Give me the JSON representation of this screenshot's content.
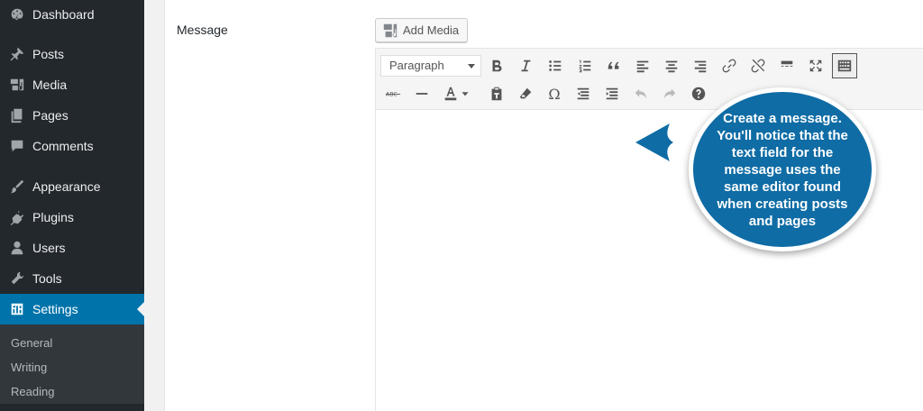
{
  "sidebar": {
    "items": [
      {
        "label": "Dashboard",
        "icon": "dashboard-icon"
      },
      {
        "label": "Posts",
        "icon": "pin-icon"
      },
      {
        "label": "Media",
        "icon": "media-icon"
      },
      {
        "label": "Pages",
        "icon": "pages-icon"
      },
      {
        "label": "Comments",
        "icon": "comment-icon"
      },
      {
        "label": "Appearance",
        "icon": "brush-icon"
      },
      {
        "label": "Plugins",
        "icon": "plugin-icon"
      },
      {
        "label": "Users",
        "icon": "user-icon"
      },
      {
        "label": "Tools",
        "icon": "wrench-icon"
      },
      {
        "label": "Settings",
        "icon": "settings-icon",
        "active": true
      }
    ],
    "submenu": [
      {
        "label": "General"
      },
      {
        "label": "Writing"
      },
      {
        "label": "Reading"
      }
    ]
  },
  "form": {
    "message_label": "Message",
    "add_media_label": "Add Media"
  },
  "editor": {
    "format_value": "Paragraph",
    "toolbar_row1": [
      "bold-icon",
      "italic-icon",
      "bullet-list-icon",
      "numbered-list-icon",
      "blockquote-icon",
      "align-left-icon",
      "align-center-icon",
      "align-right-icon",
      "link-icon",
      "unlink-icon",
      "read-more-icon",
      "fullscreen-icon",
      "toolbar-toggle-icon"
    ],
    "toolbar_row2": [
      "strikethrough-icon",
      "horizontal-line-icon",
      "text-color-icon",
      "paste-text-icon",
      "clear-formatting-icon",
      "special-character-icon",
      "outdent-icon",
      "indent-icon",
      "undo-icon",
      "redo-icon",
      "help-icon"
    ],
    "content": ""
  },
  "callout": {
    "text": "Create a message. You'll notice that the text field for the message uses the same editor found when creating posts and pages",
    "color": "#0f6ca5"
  },
  "colors": {
    "sidebar_bg": "#23282d",
    "accent": "#0073aa",
    "submenu_bg": "#32373c"
  }
}
